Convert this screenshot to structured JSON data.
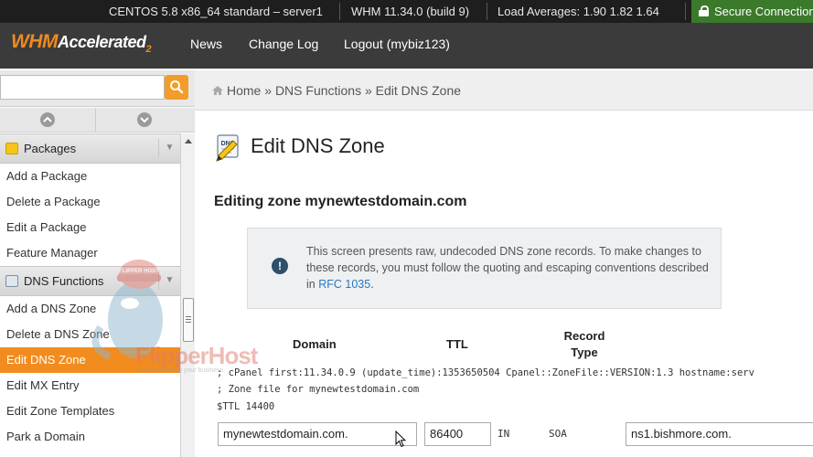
{
  "statusbar": {
    "server": "CENTOS 5.8 x86_64 standard – server1",
    "version": "WHM 11.34.0 (build 9)",
    "load": "Load Averages: 1.90 1.82 1.64",
    "secure": "Secure Connection"
  },
  "header": {
    "logo_main": "WHM",
    "logo_accel": "Accelerated",
    "logo_sub": "2",
    "nav": [
      {
        "label": "News"
      },
      {
        "label": "Change Log"
      },
      {
        "label": "Logout (mybiz123)"
      }
    ]
  },
  "search": {
    "placeholder": ""
  },
  "sidebar": {
    "groups": [
      {
        "label": "Packages",
        "items": [
          "Add a Package",
          "Delete a Package",
          "Edit a Package",
          "Feature Manager"
        ]
      },
      {
        "label": "DNS Functions",
        "items": [
          "Add a DNS Zone",
          "Delete a DNS Zone",
          "Edit DNS Zone",
          "Edit MX Entry",
          "Edit Zone Templates",
          "Park a Domain"
        ]
      }
    ],
    "active_item": "Edit DNS Zone"
  },
  "breadcrumb": {
    "home": "Home",
    "sep": "»",
    "section": "DNS Functions",
    "current": "Edit DNS Zone"
  },
  "main": {
    "title": "Edit DNS Zone",
    "title_icon_text": "DNS",
    "subtitle": "Editing zone mynewtestdomain.com",
    "notice": {
      "text_before": "This screen presents raw, undecoded DNS zone records. To make changes to these records, you must follow the quoting and escaping conventions described in ",
      "link": "RFC 1035",
      "text_after": "."
    },
    "columns": {
      "domain": "Domain",
      "ttl": "TTL",
      "record_line1": "Record",
      "record_line2": "Type"
    },
    "zone_lines": [
      "; cPanel first:11.34.0.9 (update_time):1353650504 Cpanel::ZoneFile::VERSION:1.3 hostname:serv",
      "; Zone file for mynewtestdomain.com",
      "$TTL 14400"
    ],
    "record": {
      "domain": "mynewtestdomain.com.",
      "ttl": "86400",
      "class": "IN",
      "type": "SOA",
      "value": "ns1.bishmore.com."
    }
  },
  "watermark": {
    "text": "FlipperHost",
    "sub": "an investment in your business",
    "badge": "FLIPPER HOST"
  }
}
